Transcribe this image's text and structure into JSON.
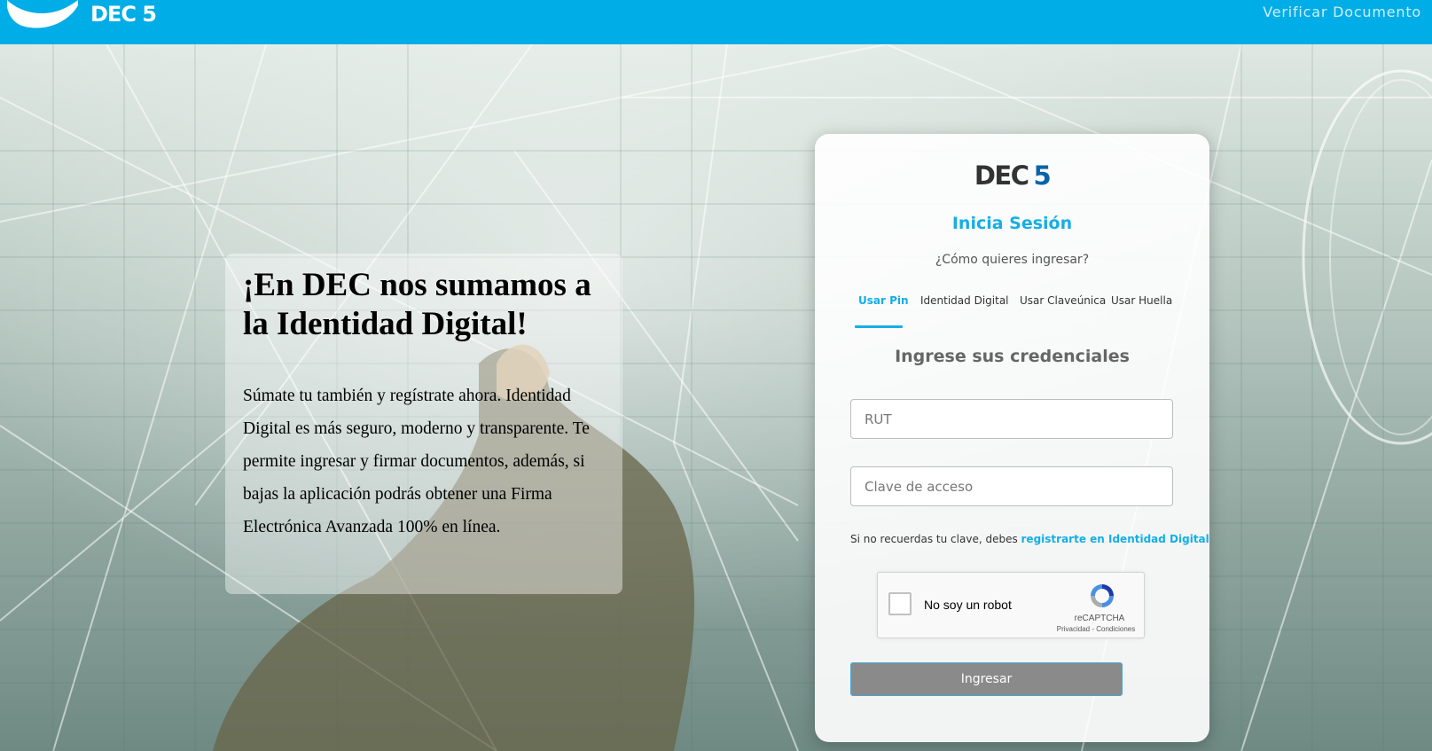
{
  "header": {
    "brand": "DEC 5",
    "verify_link": "Verificar Documento",
    "bg_color": "#00ade7"
  },
  "promo": {
    "title": "¡En DEC nos sumamos a la Identidad Digital!",
    "body": "Súmate tu también y regístrate ahora. Identidad Digital es más seguro, moderno y transparente. Te permite ingresar y firmar documentos, además, si bajas la aplicación podrás obtener una Firma Electrónica Avanzada 100% en línea."
  },
  "login": {
    "logo_text": "DEC",
    "logo_number": "5",
    "title": "Inicia Sesión",
    "subtitle": "¿Cómo quieres ingresar?",
    "tabs": [
      {
        "label": "Usar Pin",
        "active": true
      },
      {
        "label": "Identidad Digital",
        "active": false
      },
      {
        "label": "Usar Claveúnica",
        "active": false
      },
      {
        "label": "Usar Huella",
        "active": false
      }
    ],
    "section_title": "Ingrese sus credenciales",
    "rut_placeholder": "RUT",
    "password_placeholder": "Clave de acceso",
    "hint_text": "Si no recuerdas tu clave, debes ",
    "hint_link": "registrarte en Identidad Digital",
    "captcha": {
      "label": "No soy un robot",
      "brand": "reCAPTCHA",
      "privacy": "Privacidad",
      "separator": " - ",
      "terms": "Condiciones"
    },
    "submit_label": "Ingresar",
    "accent_color": "#15aee6"
  }
}
